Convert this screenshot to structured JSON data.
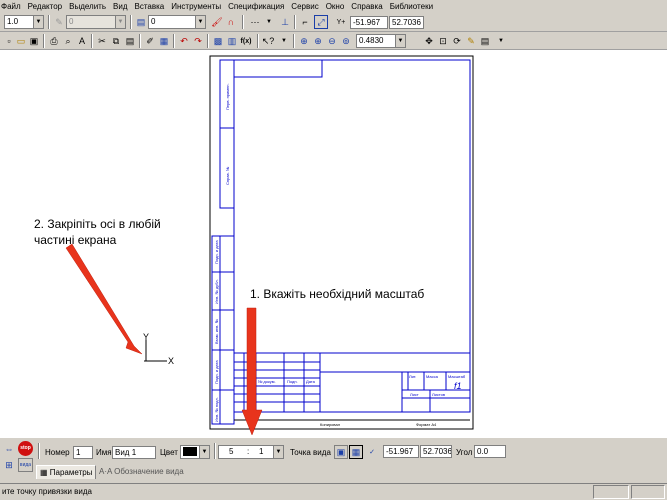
{
  "menu": [
    "Файл",
    "Редактор",
    "Выделить",
    "Вид",
    "Вставка",
    "Инструменты",
    "Спецификация",
    "Сервис",
    "Окно",
    "Справка",
    "Библиотеки"
  ],
  "toolbar1": {
    "line_width": "1.0",
    "style_value": "0",
    "layer_value": "0",
    "coord_x": "-51.967",
    "coord_y": "52.7036"
  },
  "toolbar2": {
    "zoom_value": "0.4830"
  },
  "annotations": {
    "axes_tip": "2. Закріпіть осі в любій частині екрана",
    "scale_tip": "1. Вкажіть необхідний масштаб"
  },
  "drawing": {
    "sheet_number": "f1",
    "axis_x": "X",
    "axis_y": "Y"
  },
  "properties_bar": {
    "number_label": "Номер",
    "number_value": "1",
    "name_label": "Имя",
    "name_value": "Вид 1",
    "color_label": "Цвет",
    "color_value": "#000000",
    "scale_left": "5",
    "scale_sep": ":",
    "scale_right": "1",
    "point_label": "Точка вида",
    "point_x": "-51.967",
    "point_y": "52.7036",
    "angle_label": "Угол",
    "angle_value": "0.0",
    "tab_params": "Параметры",
    "tab_designation": "Обозначение вида",
    "stop_label": "stop",
    "view_label": "вида"
  },
  "status": {
    "hint": "ите точку привязки вида"
  },
  "colors": {
    "frame_blue": "#0000cc",
    "arrow_red": "#e8341c",
    "panel_gray": "#d4d0c8"
  }
}
